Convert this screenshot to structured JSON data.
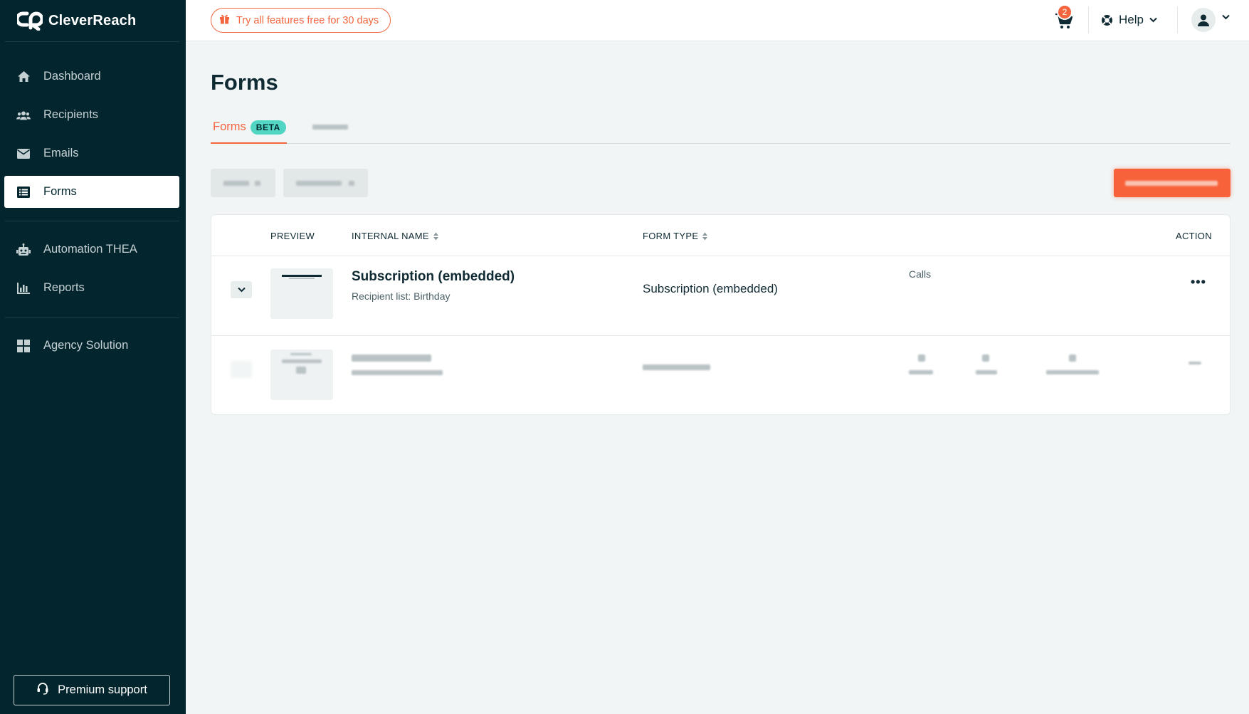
{
  "brand": {
    "name": "CleverReach",
    "accent": "#f2653f",
    "sidebar_bg": "#03262e",
    "beta_color": "#52d6c4"
  },
  "sidebar": {
    "items": [
      {
        "label": "Dashboard",
        "icon": "home-icon"
      },
      {
        "label": "Recipients",
        "icon": "users-icon"
      },
      {
        "label": "Emails",
        "icon": "envelope-icon"
      },
      {
        "label": "Forms",
        "icon": "form-list-icon",
        "active": true
      },
      {
        "label": "Automation THEA",
        "icon": "robot-icon"
      },
      {
        "label": "Reports",
        "icon": "bar-chart-icon"
      },
      {
        "label": "Agency Solution",
        "icon": "grid-icon"
      }
    ],
    "premium_support": "Premium support"
  },
  "topbar": {
    "trial_label": "Try all features free for 30 days",
    "cart_count": "2",
    "help_label": "Help"
  },
  "page": {
    "title": "Forms",
    "tabs": [
      {
        "label": "Forms",
        "badge": "BETA",
        "active": true
      }
    ]
  },
  "table": {
    "headers": {
      "preview": "PREVIEW",
      "internal_name": "INTERNAL NAME",
      "form_type": "FORM TYPE",
      "action": "ACTION"
    },
    "rows": [
      {
        "name": "Subscription (embedded)",
        "subtitle": "Recipient list: Birthday",
        "form_type": "Subscription (embedded)",
        "stat_label": "Calls"
      }
    ]
  }
}
